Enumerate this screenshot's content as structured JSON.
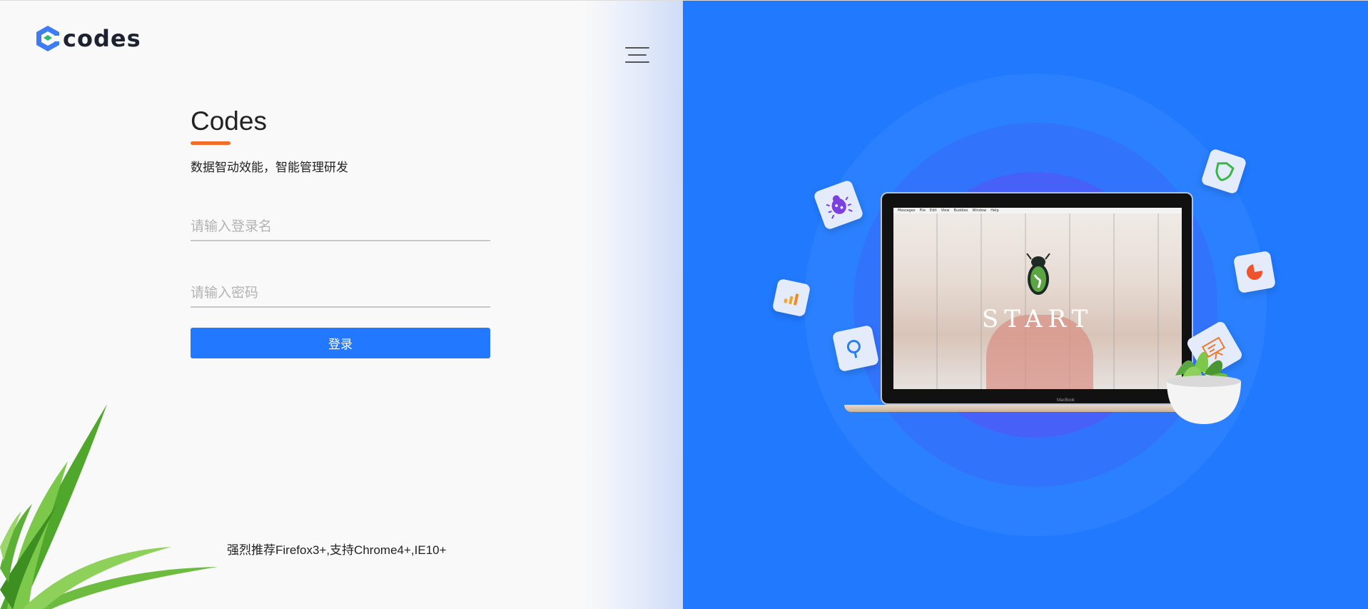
{
  "brand": {
    "logo_text": "codes",
    "title": "Codes",
    "slogan": "数据智动效能，智能管理研发"
  },
  "login_form": {
    "username_placeholder": "请输入登录名",
    "password_placeholder": "请输入密码",
    "submit_label": "登录"
  },
  "footer": {
    "browser_note": "强烈推荐Firefox3+,支持Chrome4+,IE10+"
  },
  "illustration": {
    "screen_text": "START",
    "laptop_label": "MacBook",
    "menubar_items": [
      "Messages",
      "File",
      "Edit",
      "View",
      "Buddies",
      "Window",
      "Help"
    ],
    "floating_icons": [
      "bug-icon",
      "bar-chart-icon",
      "search-icon",
      "shield-icon",
      "pie-chart-icon",
      "presentation-icon"
    ]
  },
  "colors": {
    "primary": "#2278fe",
    "accent_underline": "#f0661f",
    "right_panel_bg": "#2179fe"
  }
}
